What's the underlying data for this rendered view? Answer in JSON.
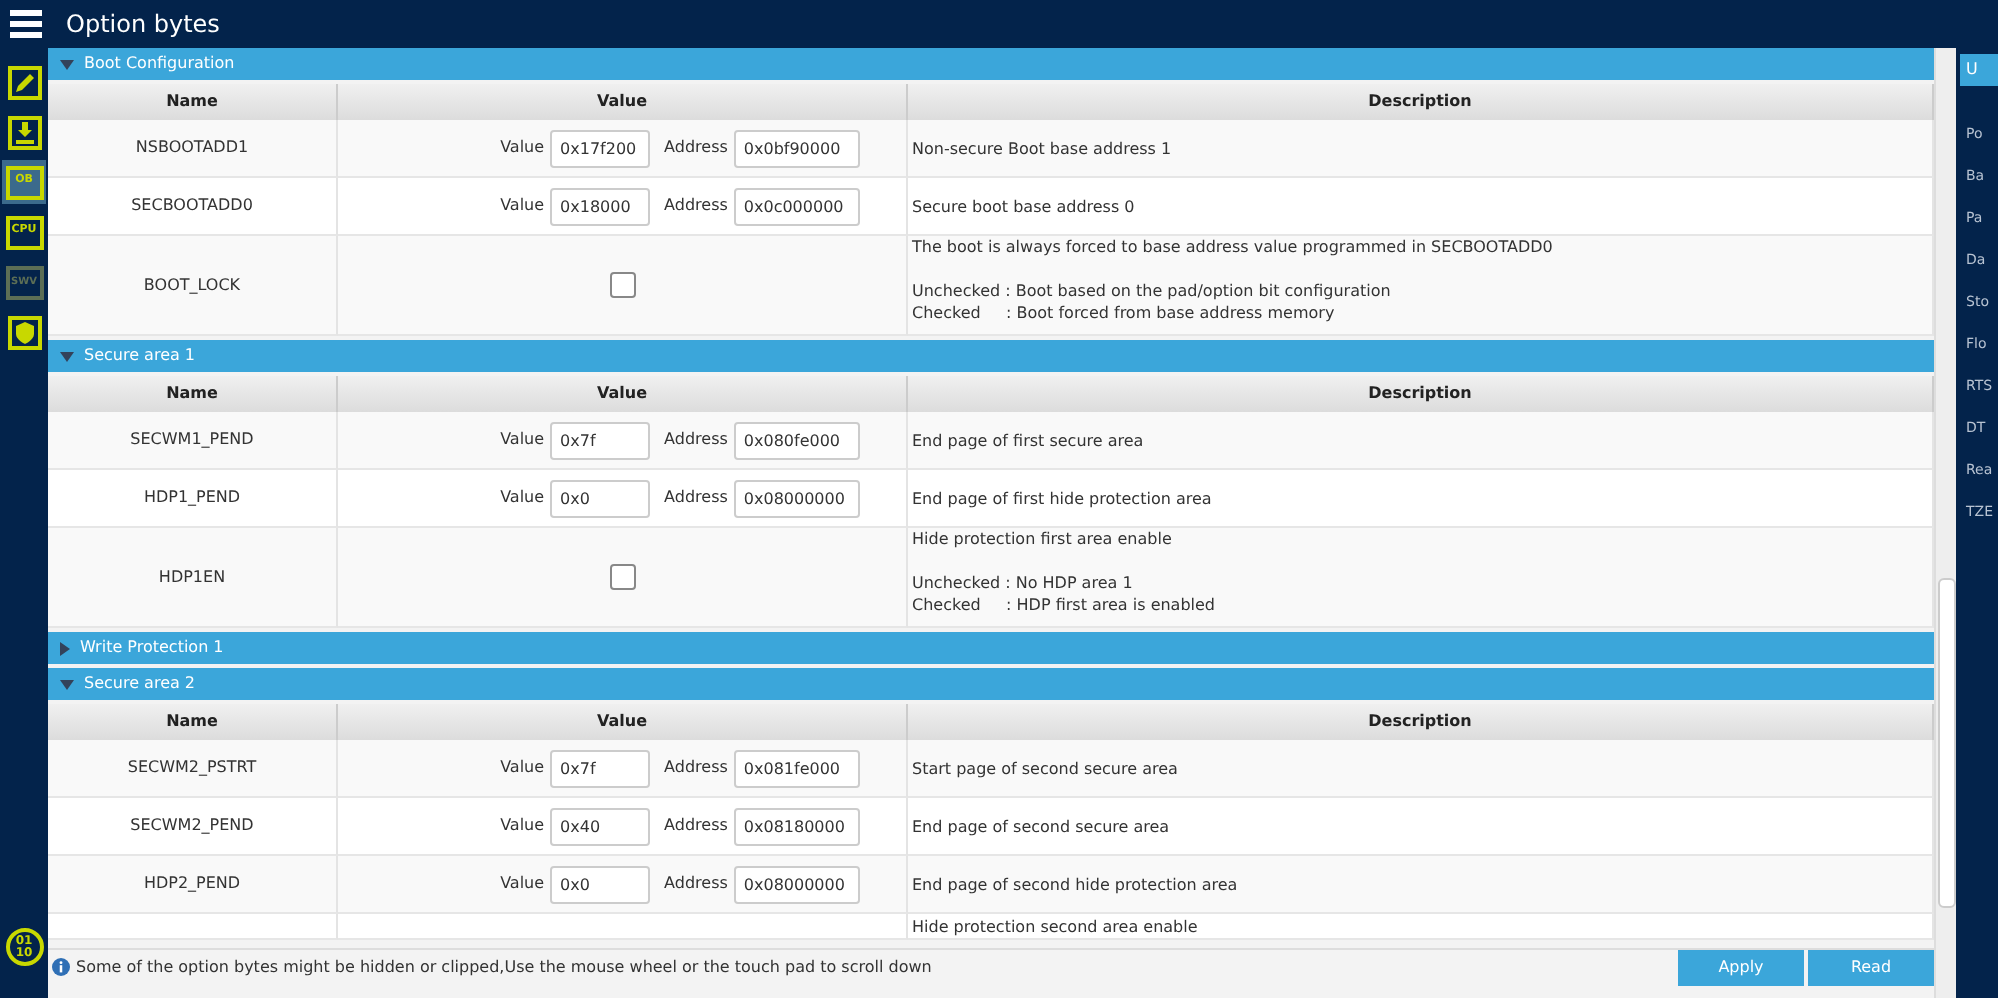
{
  "window": {
    "title": "Option bytes"
  },
  "sidebar": {
    "items": [
      {
        "kind": "pencil",
        "selected": false
      },
      {
        "kind": "download",
        "selected": false
      },
      {
        "kind": "text",
        "label": "OB",
        "selected": true
      },
      {
        "kind": "text",
        "label": "CPU",
        "selected": false
      },
      {
        "kind": "text",
        "label": "SWV",
        "selected": false,
        "disabled": true
      },
      {
        "kind": "shield",
        "selected": false
      }
    ],
    "bottom": {
      "line_1": "01",
      "line_2": "10"
    }
  },
  "sections": [
    {
      "title": "Boot Configuration",
      "expanded": true,
      "columns": [
        "Name",
        "Value",
        "Description"
      ],
      "rows": [
        {
          "kind": "fields",
          "name": "NSBOOTADD1",
          "value_label": "Value",
          "value": "0x17f200",
          "address_label": "Address",
          "address": "0x0bf90000",
          "description": [
            [
              "Non-secure Boot base address 1"
            ]
          ]
        },
        {
          "kind": "fields",
          "name": "SECBOOTADD0",
          "value_label": "Value",
          "value": "0x18000",
          "address_label": "Address",
          "address": "0x0c000000",
          "description": [
            [
              "Secure boot base address 0"
            ]
          ]
        },
        {
          "kind": "checkbox",
          "name": "BOOT_LOCK",
          "checked": false,
          "description": [
            [
              "The boot is always forced to base address value programmed in SECBOOTADD0"
            ],
            [
              "Unchecked : Boot based on the pad/option bit configuration",
              "Checked     : Boot forced from base address memory"
            ]
          ]
        }
      ]
    },
    {
      "title": "Secure area 1",
      "expanded": true,
      "columns": [
        "Name",
        "Value",
        "Description"
      ],
      "rows": [
        {
          "kind": "fields",
          "name": "SECWM1_PEND",
          "value_label": "Value",
          "value": "0x7f",
          "address_label": "Address",
          "address": "0x080fe000",
          "description": [
            [
              "End page of first secure area"
            ]
          ]
        },
        {
          "kind": "fields",
          "name": "HDP1_PEND",
          "value_label": "Value",
          "value": "0x0",
          "address_label": "Address",
          "address": "0x08000000",
          "description": [
            [
              "End page of first hide protection area"
            ]
          ]
        },
        {
          "kind": "checkbox",
          "name": "HDP1EN",
          "checked": false,
          "description": [
            [
              "Hide protection first area enable"
            ],
            [
              "Unchecked : No HDP area 1",
              "Checked     : HDP first area is enabled"
            ]
          ]
        }
      ]
    },
    {
      "title": "Write Protection 1",
      "expanded": false
    },
    {
      "title": "Secure area 2",
      "expanded": true,
      "columns": [
        "Name",
        "Value",
        "Description"
      ],
      "rows": [
        {
          "kind": "fields",
          "name": "SECWM2_PSTRT",
          "value_label": "Value",
          "value": "0x7f",
          "address_label": "Address",
          "address": "0x081fe000",
          "description": [
            [
              "Start page of second secure area"
            ]
          ]
        },
        {
          "kind": "fields",
          "name": "SECWM2_PEND",
          "value_label": "Value",
          "value": "0x40",
          "address_label": "Address",
          "address": "0x08180000",
          "description": [
            [
              "End page of second secure area"
            ]
          ]
        },
        {
          "kind": "fields",
          "name": "HDP2_PEND",
          "value_label": "Value",
          "value": "0x0",
          "address_label": "Address",
          "address": "0x08000000",
          "description": [
            [
              "End page of second hide protection area"
            ]
          ]
        },
        {
          "kind": "partial",
          "description": [
            [
              "Hide protection second area enable"
            ]
          ]
        }
      ]
    }
  ],
  "status_bar": {
    "message": "Some of the option bytes might be hidden or clipped,Use the mouse wheel or the touch pad to scroll down",
    "buttons": [
      "Apply",
      "Read"
    ]
  },
  "right_panel": {
    "button": "U",
    "labels": [
      "Po",
      "Ba",
      "Pa",
      "Da",
      "Sto",
      "Flo",
      "RTS",
      "DT",
      "Rea",
      "TZE"
    ]
  }
}
